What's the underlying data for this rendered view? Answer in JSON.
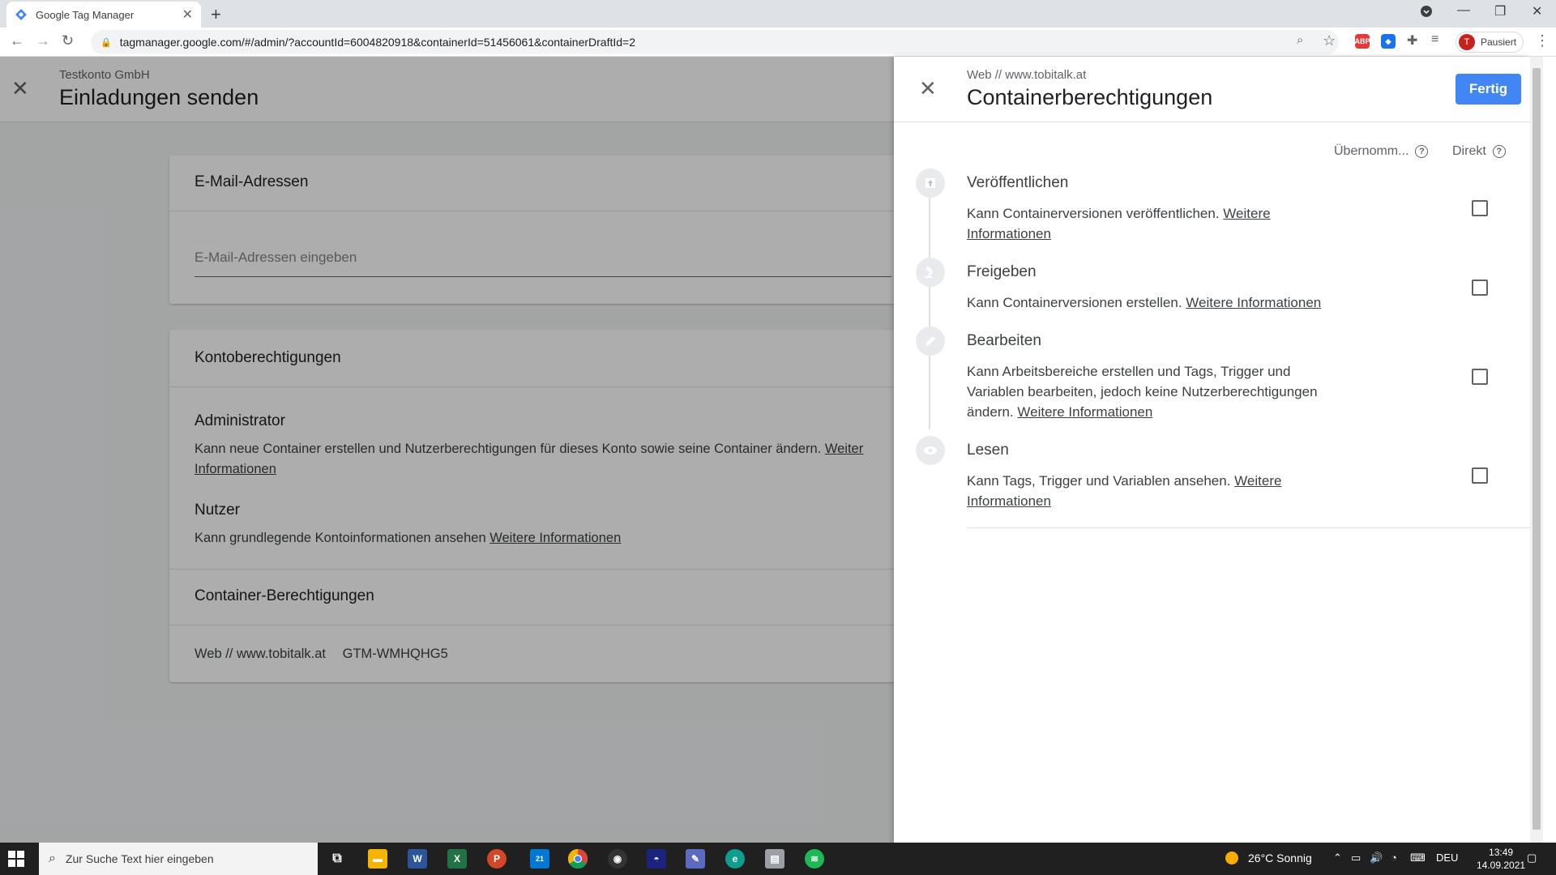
{
  "browser": {
    "tab_title": "Google Tag Manager",
    "url": "tagmanager.google.com/#/admin/?accountId=6004820918&containerId=51456061&containerDraftId=2",
    "profile_label": "Pausiert",
    "profile_initial": "T"
  },
  "left": {
    "account": "Testkonto GmbH",
    "title": "Einladungen senden",
    "email_section": "E-Mail-Adressen",
    "email_placeholder": "E-Mail-Adressen eingeben",
    "account_perm_section": "Kontoberechtigungen",
    "admin_title": "Administrator",
    "admin_desc": "Kann neue Container erstellen und Nutzerberechtigungen für dieses Konto sowie seine Container ändern.",
    "admin_link_1": "Weiter",
    "admin_link_2": "Informationen",
    "user_title": "Nutzer",
    "user_desc": "Kann grundlegende Kontoinformationen ansehen",
    "user_link": "Weitere Informationen",
    "container_perm_section": "Container-Berechtigungen",
    "container_name": "Web // www.tobitalk.at",
    "container_id": "GTM-WMHQHG5"
  },
  "panel": {
    "subtitle": "Web // www.tobitalk.at",
    "title": "Containerberechtigungen",
    "done_button": "Fertig",
    "col_inherited": "Übernomm...",
    "col_direct": "Direkt",
    "permissions": [
      {
        "title": "Veröffentlichen",
        "desc": "Kann Containerversionen veröffentlichen.",
        "link1": "Weitere",
        "link2": "Informationen",
        "icon": "publish-icon",
        "checked": false
      },
      {
        "title": "Freigeben",
        "desc": "Kann Containerversionen erstellen.",
        "link1": "Weitere Informationen",
        "link2": "",
        "icon": "approve-gavel-icon",
        "checked": false
      },
      {
        "title": "Bearbeiten",
        "desc_l1": "Kann Arbeitsbereiche erstellen und Tags, Trigger und",
        "desc_l2": "Variablen bearbeiten, jedoch keine Nutzerberechtigungen",
        "desc_l3": "ändern.",
        "link1": "Weitere Informationen",
        "icon": "edit-pencil-icon",
        "checked": false
      },
      {
        "title": "Lesen",
        "desc": "Kann Tags, Trigger und Variablen ansehen.",
        "link1": "Weitere",
        "link2": "Informationen",
        "icon": "view-eye-icon",
        "checked": false
      }
    ]
  },
  "taskbar": {
    "search_placeholder": "Zur Suche Text hier eingeben",
    "mail_badge": "21",
    "weather": "26°C  Sonnig",
    "language": "DEU",
    "time": "13:49",
    "date": "14.09.2021"
  },
  "colors": {
    "primary_blue": "#4285f4",
    "overlay": "rgba(0,0,0,0.32)",
    "taskbar": "#202020"
  }
}
